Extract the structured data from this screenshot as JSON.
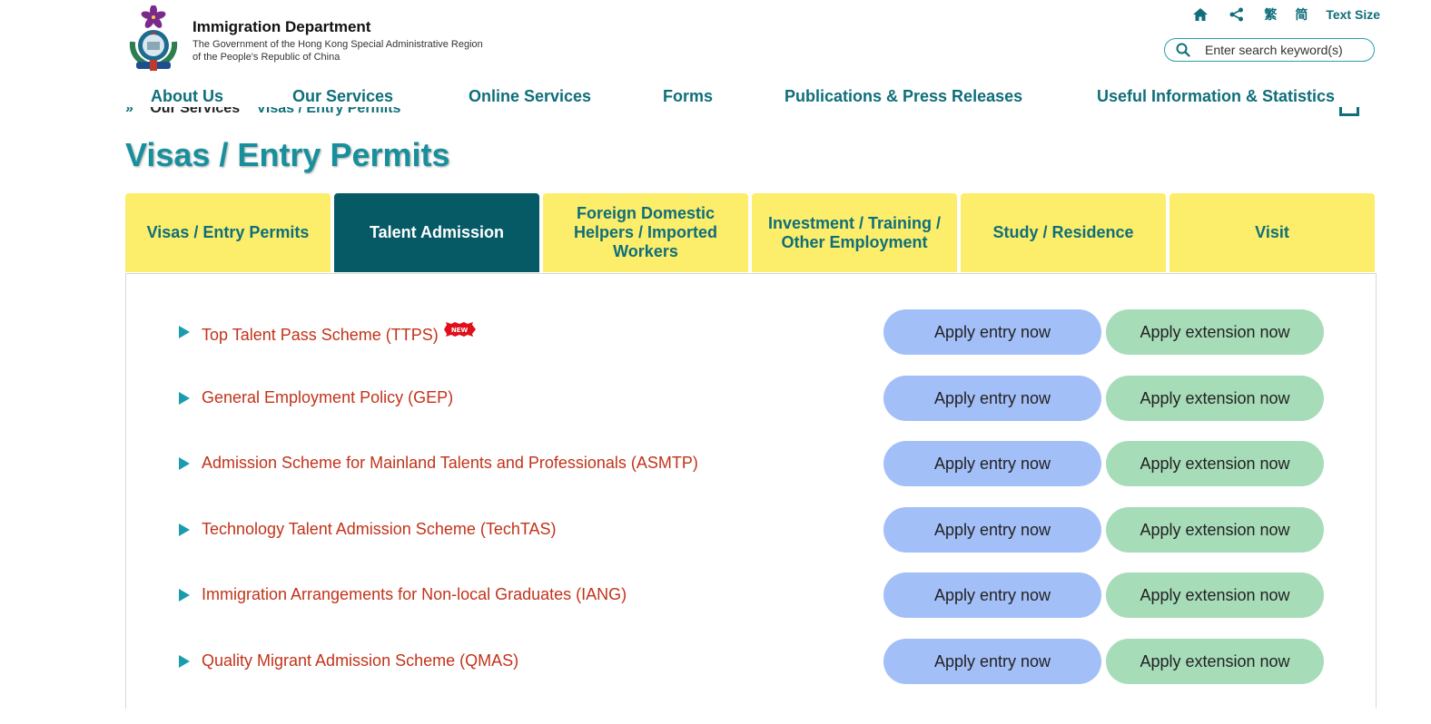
{
  "header": {
    "department": "Immigration Department",
    "subtitle_line1": "The Government of the Hong Kong Special Administrative Region",
    "subtitle_line2": "of the People's Republic of China",
    "logo_icon": "hksar-emblem-icon"
  },
  "utility": {
    "home_icon": "home-icon",
    "share_icon": "share-icon",
    "lang_traditional": "繁",
    "lang_simplified": "简",
    "text_size_label": "Text Size"
  },
  "search": {
    "placeholder": "Enter search keyword(s)",
    "value": "",
    "icon": "search-icon"
  },
  "nav": {
    "items": [
      {
        "label": "About Us"
      },
      {
        "label": "Our Services"
      },
      {
        "label": "Online Services"
      },
      {
        "label": "Forms"
      },
      {
        "label": "Publications & Press Releases"
      },
      {
        "label": "Useful Information & Statistics"
      }
    ]
  },
  "breadcrumb": {
    "home": "»",
    "level1": "Our Services",
    "current": "Visas / Entry Permits"
  },
  "page": {
    "title": "Visas / Entry Permits"
  },
  "tabs": [
    {
      "label": "Visas / Entry Permits",
      "active": false
    },
    {
      "label": "Talent Admission",
      "active": true
    },
    {
      "label": "Foreign Domestic Helpers / Imported Workers",
      "active": false
    },
    {
      "label": "Investment / Training / Other Employment",
      "active": false
    },
    {
      "label": "Study / Residence",
      "active": false
    },
    {
      "label": "Visit",
      "active": false
    }
  ],
  "schemes": [
    {
      "name": "Top Talent Pass Scheme (TTPS)",
      "badge": "NEW",
      "entry_label": "Apply entry now",
      "extension_label": "Apply extension now"
    },
    {
      "name": "General Employment Policy (GEP)",
      "entry_label": "Apply entry now",
      "extension_label": "Apply extension now"
    },
    {
      "name": "Admission Scheme for Mainland Talents and Professionals (ASMTP)",
      "entry_label": "Apply entry now",
      "extension_label": "Apply extension now"
    },
    {
      "name": "Technology Talent Admission Scheme (TechTAS)",
      "entry_label": "Apply entry now",
      "extension_label": "Apply extension now"
    },
    {
      "name": "Immigration Arrangements for Non-local Graduates (IANG)",
      "entry_label": "Apply entry now",
      "extension_label": "Apply extension now"
    },
    {
      "name": "Quality Migrant Admission Scheme (QMAS)",
      "entry_label": "Apply entry now",
      "extension_label": "Apply extension now"
    }
  ],
  "colors": {
    "brand_teal": "#0f6e7a",
    "title_teal": "#18909c",
    "tab_yellow": "#fcee6a",
    "tab_active": "#055a66",
    "link_red": "#c2331a",
    "entry_button": "#a3bff8",
    "extension_button": "#a7dcb9",
    "badge_red": "#e0101a"
  }
}
